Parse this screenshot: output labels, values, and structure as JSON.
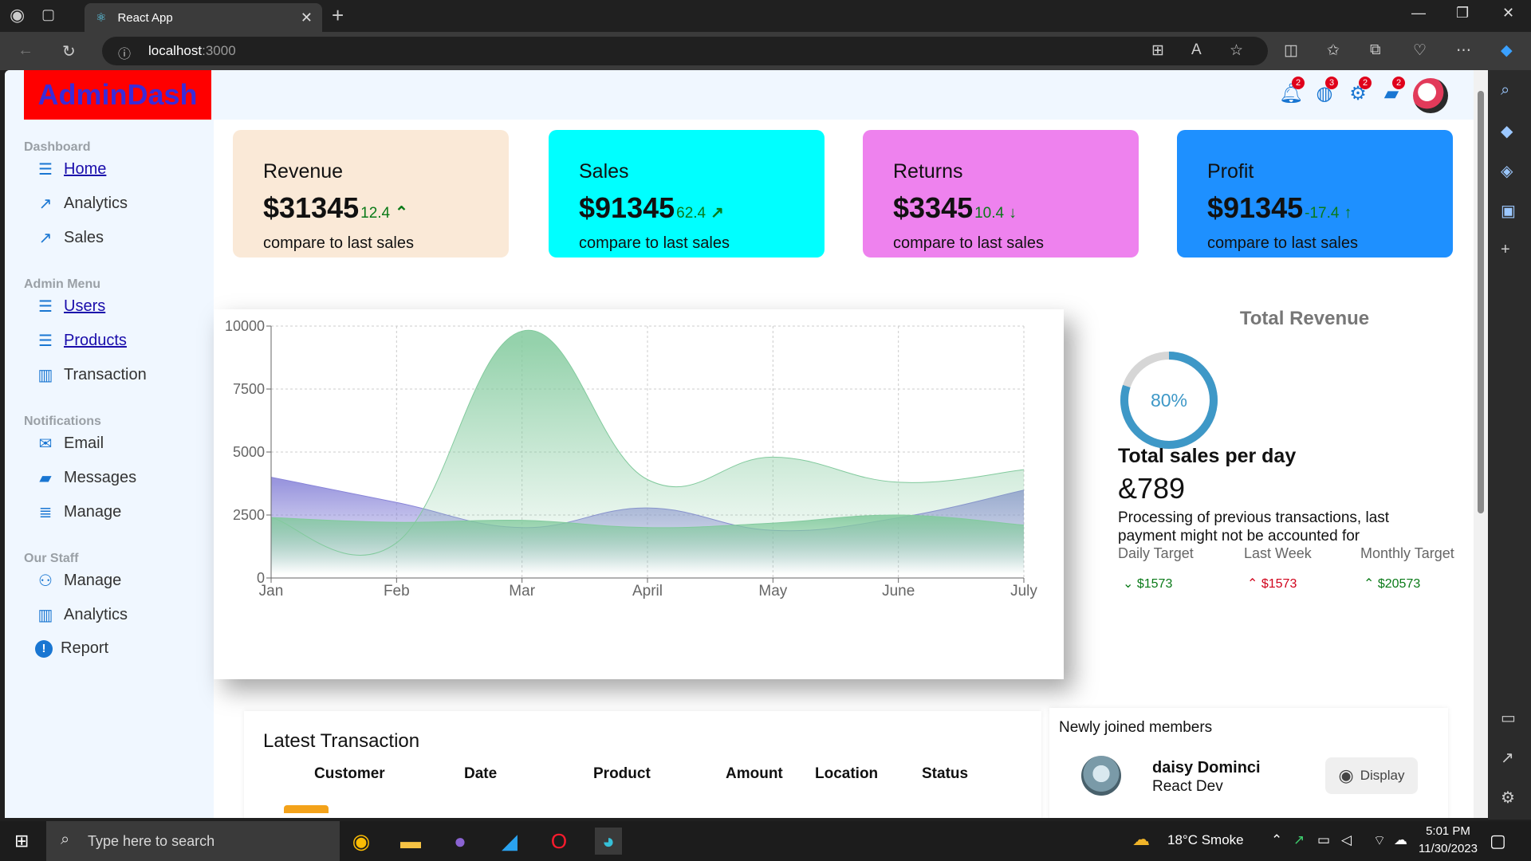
{
  "browser": {
    "tab_title": "React App",
    "url_host": "localhost",
    "url_port": ":3000"
  },
  "app": {
    "logo": "AdminDash",
    "sidebar": {
      "sections": [
        {
          "title": "Dashboard",
          "items": [
            {
              "label": "Home",
              "icon": "table-icon",
              "link": true
            },
            {
              "label": "Analytics",
              "icon": "trend-icon",
              "link": false
            },
            {
              "label": "Sales",
              "icon": "trend-icon",
              "link": false
            }
          ]
        },
        {
          "title": "Admin Menu",
          "items": [
            {
              "label": "Users",
              "icon": "table-icon",
              "link": true
            },
            {
              "label": "Products",
              "icon": "table-icon",
              "link": true
            },
            {
              "label": "Transaction",
              "icon": "bar-chart-icon",
              "link": false
            }
          ]
        },
        {
          "title": "Notifications",
          "items": [
            {
              "label": "Email",
              "icon": "mail-icon",
              "link": false
            },
            {
              "label": "Messages",
              "icon": "chat-icon",
              "link": false
            },
            {
              "label": "Manage",
              "icon": "list-icon",
              "link": false
            }
          ]
        },
        {
          "title": "Our Staff",
          "items": [
            {
              "label": "Manage",
              "icon": "user-gear-icon",
              "link": false
            },
            {
              "label": "Analytics",
              "icon": "bar-chart-icon",
              "link": false
            },
            {
              "label": "Report",
              "icon": "alert-icon",
              "link": false
            }
          ]
        }
      ]
    },
    "topbar": {
      "badges": [
        "2",
        "3",
        "2",
        "2"
      ]
    },
    "cards": [
      {
        "title": "Revenue",
        "value": "$31345",
        "pct": "12.4",
        "arrow": "^",
        "subtitle": "compare to last sales",
        "bg": "#fae9d7"
      },
      {
        "title": "Sales",
        "value": "$91345",
        "pct": "62.4",
        "arrow": "↗",
        "subtitle": "compare to last sales",
        "bg": "#00ffff"
      },
      {
        "title": "Returns",
        "value": "$3345",
        "pct": "10.4",
        "arrow": "↓",
        "subtitle": "compare to last sales",
        "bg": "#ee82ee"
      },
      {
        "title": "Profit",
        "value": "$91345",
        "pct": "-17.4",
        "arrow": "↑",
        "subtitle": "compare to last sales",
        "bg": "#1e90ff"
      }
    ],
    "total_revenue": {
      "title": "Total Revenue",
      "percent_label": "80%",
      "percent_value": 80,
      "heading": "Total sales per day",
      "amount": "&789",
      "description": "Processing of previous transactions, last payment might not be accounted for",
      "targets": [
        {
          "label": "Daily Target",
          "value": "$1573",
          "direction": "down",
          "color": "#0a7a18"
        },
        {
          "label": "Last Week",
          "value": "$1573",
          "direction": "up",
          "color": "#d0021b"
        },
        {
          "label": "Monthly Target",
          "value": "$20573",
          "direction": "up",
          "color": "#0a7a18"
        }
      ]
    },
    "transactions": {
      "title": "Latest Transaction",
      "columns": [
        "Customer",
        "Date",
        "Product",
        "Amount",
        "Location",
        "Status"
      ]
    },
    "members": {
      "title": "Newly joined members",
      "name": "daisy Dominci",
      "role": "React Dev",
      "button": "Display"
    }
  },
  "chart_data": {
    "type": "area",
    "categories": [
      "Jan",
      "Feb",
      "Mar",
      "April",
      "May",
      "June",
      "July"
    ],
    "ylim": [
      0,
      10000
    ],
    "yticks": [
      0,
      2500,
      5000,
      7500,
      10000
    ],
    "grid": true,
    "series": [
      {
        "values": [
          4000,
          3000,
          2000,
          2780,
          1890,
          2390,
          3490
        ],
        "color": "#8884d8"
      },
      {
        "values": [
          2400,
          1398,
          9800,
          3908,
          4800,
          3800,
          4300
        ],
        "color": "#82ca9d"
      },
      {
        "values": [
          2400,
          2210,
          2290,
          2000,
          2181,
          2500,
          2100
        ],
        "color": "#82ca9d"
      }
    ]
  },
  "taskbar": {
    "search_placeholder": "Type here to search",
    "weather": "18°C  Smoke",
    "time": "5:01 PM",
    "date": "11/30/2023"
  }
}
